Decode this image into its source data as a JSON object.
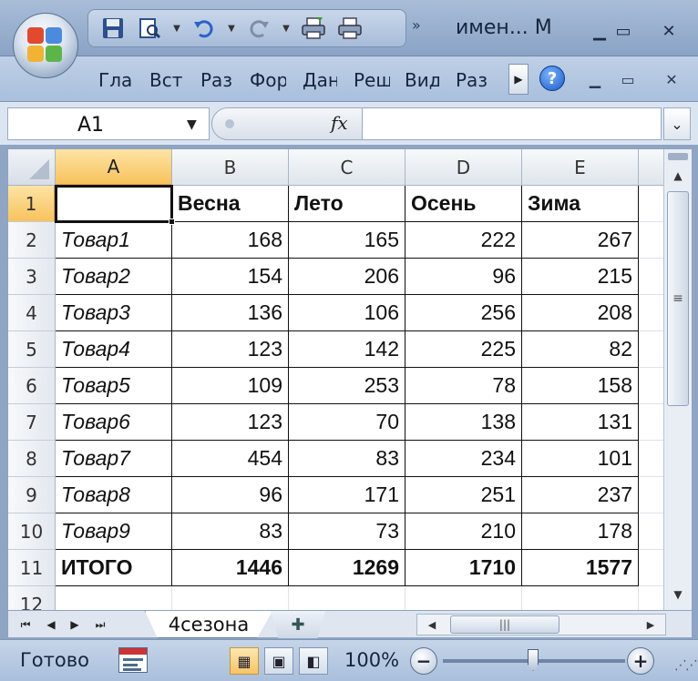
{
  "window": {
    "title": "имен... М",
    "controls": [
      "minimize",
      "restore",
      "close"
    ]
  },
  "quick_access": {
    "items": [
      "save-icon",
      "print-preview-icon",
      "undo-icon",
      "redo-icon",
      "print-icon",
      "print-icon"
    ]
  },
  "ribbon": {
    "tabs": [
      "Гла",
      "Вст",
      "Раз",
      "Фор",
      "Дан",
      "Реш",
      "Вид",
      "Раз"
    ]
  },
  "formula_bar": {
    "name_box": "A1",
    "fx_label": "fx",
    "formula": ""
  },
  "sheet": {
    "columns": [
      "A",
      "B",
      "C",
      "D",
      "E"
    ],
    "row_numbers": [
      "1",
      "2",
      "3",
      "4",
      "5",
      "6",
      "7",
      "8",
      "9",
      "10",
      "11",
      "12"
    ],
    "header_row": [
      "",
      "Весна",
      "Лето",
      "Осень",
      "Зима"
    ],
    "rows": [
      [
        "Товар1",
        "168",
        "165",
        "222",
        "267"
      ],
      [
        "Товар2",
        "154",
        "206",
        "96",
        "215"
      ],
      [
        "Товар3",
        "136",
        "106",
        "256",
        "208"
      ],
      [
        "Товар4",
        "123",
        "142",
        "225",
        "82"
      ],
      [
        "Товар5",
        "109",
        "253",
        "78",
        "158"
      ],
      [
        "Товар6",
        "123",
        "70",
        "138",
        "131"
      ],
      [
        "Товар7",
        "454",
        "83",
        "234",
        "101"
      ],
      [
        "Товар8",
        "96",
        "171",
        "251",
        "237"
      ],
      [
        "Товар9",
        "83",
        "73",
        "210",
        "178"
      ]
    ],
    "total_row": [
      "ИТОГО",
      "1446",
      "1269",
      "1710",
      "1577"
    ],
    "tab_name": "4сезона"
  },
  "status_bar": {
    "status": "Готово",
    "zoom": "100%"
  }
}
